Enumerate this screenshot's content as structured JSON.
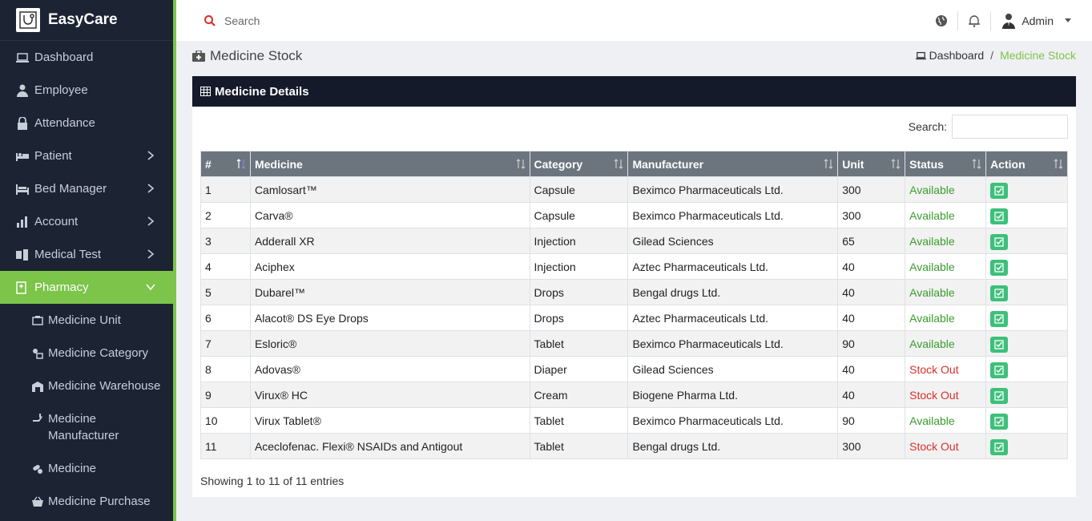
{
  "app": {
    "name": "EasyCare"
  },
  "sidebar": {
    "items": [
      {
        "label": "Dashboard",
        "icon": "laptop-icon"
      },
      {
        "label": "Employee",
        "icon": "user-icon"
      },
      {
        "label": "Attendance",
        "icon": "lock-icon"
      },
      {
        "label": "Patient",
        "icon": "bed-icon"
      },
      {
        "label": "Bed Manager",
        "icon": "bed-frame-icon"
      },
      {
        "label": "Account",
        "icon": "bar-chart-icon"
      },
      {
        "label": "Medical Test",
        "icon": "flask-icon"
      },
      {
        "label": "Pharmacy",
        "icon": "pharmacy-icon"
      }
    ],
    "pharmacy_subitems": [
      {
        "label": "Medicine Unit"
      },
      {
        "label": "Medicine Category"
      },
      {
        "label": "Medicine Warehouse"
      },
      {
        "label": "Medicine Manufacturer"
      },
      {
        "label": "Medicine"
      },
      {
        "label": "Medicine Purchase"
      }
    ]
  },
  "topbar": {
    "search_placeholder": "Search",
    "user_name": "Admin"
  },
  "page": {
    "title": "Medicine Stock",
    "breadcrumb_home": "Dashboard",
    "breadcrumb_sep": "/",
    "breadcrumb_current": "Medicine Stock"
  },
  "card": {
    "title": "Medicine Details",
    "search_label": "Search:",
    "info": "Showing 1 to 11 of 11 entries"
  },
  "table": {
    "headers": [
      "#",
      "Medicine",
      "Category",
      "Manufacturer",
      "Unit",
      "Status",
      "Action"
    ],
    "rows": [
      {
        "num": "1",
        "medicine": "Camlosart™",
        "category": "Capsule",
        "manufacturer": "Beximco Pharmaceuticals Ltd.",
        "unit": "300",
        "status": "Available"
      },
      {
        "num": "2",
        "medicine": "Carva®",
        "category": "Capsule",
        "manufacturer": "Beximco Pharmaceuticals Ltd.",
        "unit": "300",
        "status": "Available"
      },
      {
        "num": "3",
        "medicine": "Adderall XR",
        "category": "Injection",
        "manufacturer": "Gilead Sciences",
        "unit": "65",
        "status": "Available"
      },
      {
        "num": "4",
        "medicine": "Aciphex",
        "category": "Injection",
        "manufacturer": "Aztec Pharmaceuticals Ltd.",
        "unit": "40",
        "status": "Available"
      },
      {
        "num": "5",
        "medicine": "Dubarel™",
        "category": "Drops",
        "manufacturer": "Bengal drugs Ltd.",
        "unit": "40",
        "status": "Available"
      },
      {
        "num": "6",
        "medicine": "Alacot® DS Eye Drops",
        "category": "Drops",
        "manufacturer": "Aztec Pharmaceuticals Ltd.",
        "unit": "40",
        "status": "Available"
      },
      {
        "num": "7",
        "medicine": "Esloric®",
        "category": "Tablet",
        "manufacturer": "Beximco Pharmaceuticals Ltd.",
        "unit": "90",
        "status": "Available"
      },
      {
        "num": "8",
        "medicine": "Adovas®",
        "category": "Diaper",
        "manufacturer": "Gilead Sciences",
        "unit": "40",
        "status": "Stock Out"
      },
      {
        "num": "9",
        "medicine": "Virux® HC",
        "category": "Cream",
        "manufacturer": "Biogene Pharma Ltd.",
        "unit": "40",
        "status": "Stock Out"
      },
      {
        "num": "10",
        "medicine": "Virux Tablet®",
        "category": "Tablet",
        "manufacturer": "Beximco Pharmaceuticals Ltd.",
        "unit": "90",
        "status": "Available"
      },
      {
        "num": "11",
        "medicine": "Aceclofenac. Flexi® NSAIDs and Antigout",
        "category": "Tablet",
        "manufacturer": "Bengal drugs Ltd.",
        "unit": "300",
        "status": "Stock Out"
      }
    ]
  },
  "colors": {
    "accent": "#7cc44a",
    "sidebar_bg": "#1c2333",
    "header_bg": "#141a2a",
    "available": "#3a9d2e",
    "stock_out": "#d9302c",
    "action_btn": "#3dc07a"
  }
}
